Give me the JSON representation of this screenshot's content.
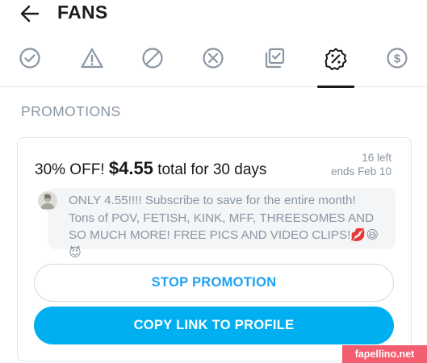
{
  "header": {
    "title": "FANS"
  },
  "tabs": [
    {
      "name": "active",
      "icon": "check-circle-icon"
    },
    {
      "name": "warning",
      "icon": "warning-triangle-icon"
    },
    {
      "name": "restricted",
      "icon": "prohibited-circle-icon"
    },
    {
      "name": "blocked",
      "icon": "x-circle-icon"
    },
    {
      "name": "expired",
      "icon": "checkbox-stack-icon"
    },
    {
      "name": "promotions",
      "icon": "discount-badge-icon",
      "active": true
    },
    {
      "name": "spent",
      "icon": "dollar-circle-icon"
    }
  ],
  "section": {
    "title": "PROMOTIONS"
  },
  "promo": {
    "discount": "30% OFF!",
    "price": "$4.55",
    "period": "total for 30 days",
    "left": "16 left",
    "ends": "ends Feb 10",
    "message": "ONLY 4.55!!!! Subscribe to save for the entire month! Tons of POV, FETISH, KINK, MFF, THREESOMES AND SO MUCH MORE! FREE PICS AND VIDEO CLIPS!💋😆😈",
    "stop_label": "STOP PROMOTION",
    "copy_label": "COPY LINK TO PROFILE"
  },
  "watermark": "fapellino.net",
  "colors": {
    "accent": "#00aff0",
    "link": "#1da1f2",
    "muted": "#8a96a3",
    "icon": "#8a96a3",
    "active_icon": "#1a1a1a"
  }
}
